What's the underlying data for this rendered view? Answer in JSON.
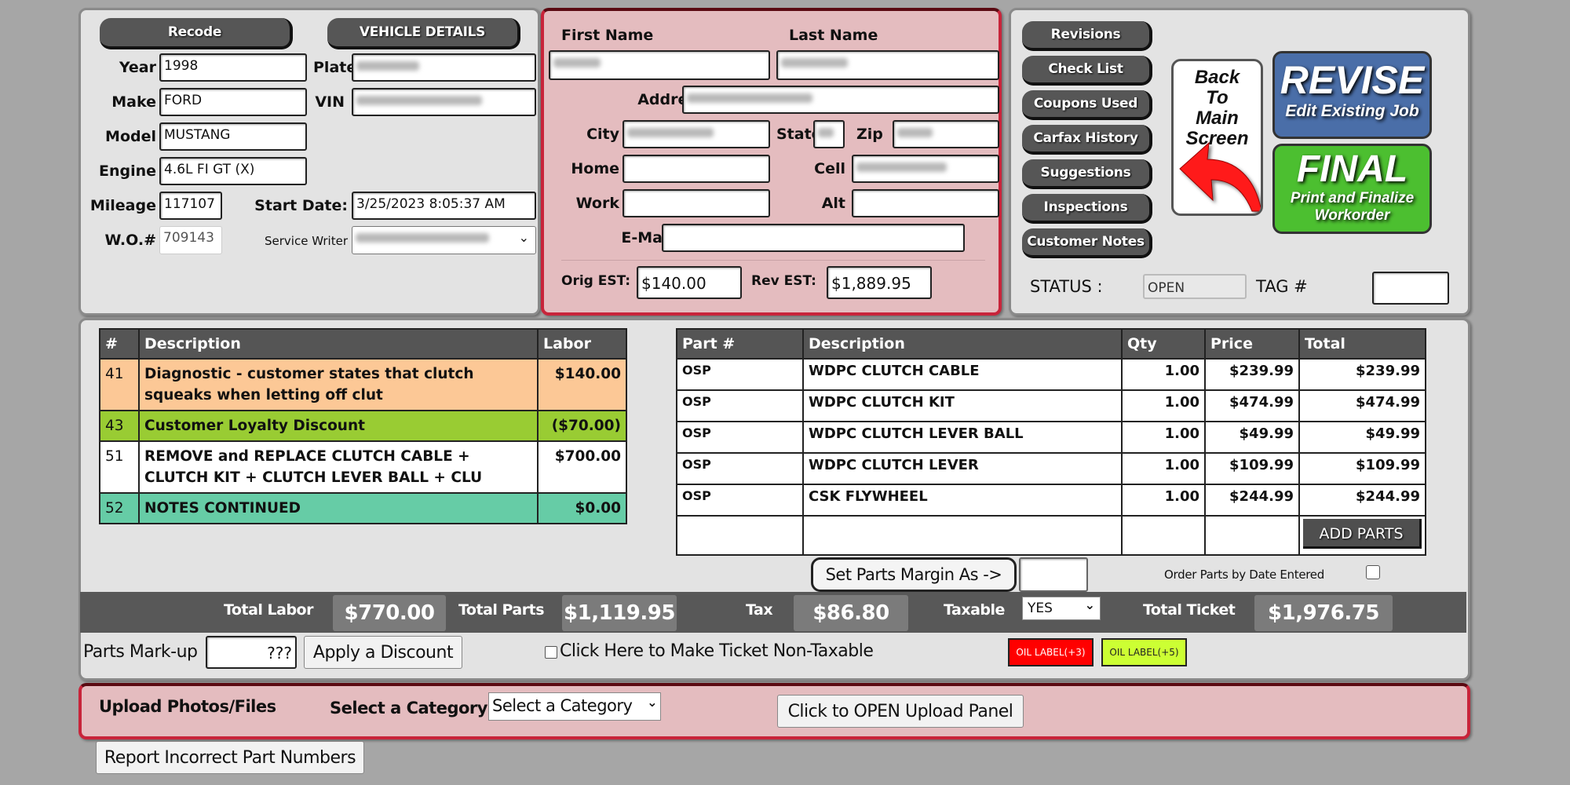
{
  "vehicle": {
    "recode_label": "Recode",
    "details_label": "VEHICLE DETAILS",
    "year_label": "Year",
    "year": "1998",
    "plate_label": "Plate",
    "make_label": "Make",
    "make": "FORD",
    "vin_label": "VIN",
    "model_label": "Model",
    "model": "MUSTANG",
    "engine_label": "Engine",
    "engine": "4.6L FI GT (X)",
    "mileage_label": "Mileage",
    "mileage": "117107",
    "start_date_label": "Start Date:",
    "start_date": "3/25/2023 8:05:37 AM",
    "wo_label": "W.O.#",
    "wo": "709143",
    "service_writer_label": "Service Writer"
  },
  "customer": {
    "first_name_label": "First Name",
    "last_name_label": "Last Name",
    "address_label": "Address",
    "city_label": "City",
    "state_label": "State",
    "zip_label": "Zip",
    "home_label": "Home",
    "cell_label": "Cell",
    "work_label": "Work",
    "alt_label": "Alt",
    "email_label": "E-Mail",
    "orig_est_label": "Orig EST:",
    "orig_est": "$140.00",
    "rev_est_label": "Rev EST:",
    "rev_est": "$1,889.95"
  },
  "actions": {
    "side_buttons": [
      "Revisions",
      "Check List",
      "Coupons Used",
      "Carfax History",
      "Suggestions",
      "Inspections",
      "Customer Notes"
    ],
    "back_label": [
      "Back",
      "To",
      "Main",
      "Screen"
    ],
    "revise_title": "REVISE",
    "revise_sub": "Edit Existing Job",
    "final_title": "FINAL",
    "final_sub1": "Print and Finalize",
    "final_sub2": "Workorder",
    "status_label": "STATUS :",
    "status_value": "OPEN",
    "tag_label": "TAG #",
    "tag_value": ""
  },
  "labor": {
    "headers": [
      "#",
      "Description",
      "Labor"
    ],
    "rows": [
      {
        "num": "41",
        "desc": "Diagnostic - customer states that clutch squeaks when letting off clut",
        "amount": "$140.00",
        "color": "#fcc896"
      },
      {
        "num": "43",
        "desc": "Customer Loyalty Discount",
        "amount": "($70.00)",
        "color": "#99cc33"
      },
      {
        "num": "51",
        "desc": "REMOVE and REPLACE CLUTCH CABLE + CLUTCH KIT + CLUTCH LEVER BALL + CLU",
        "amount": "$700.00",
        "color": "#ffffff"
      },
      {
        "num": "52",
        "desc": "NOTES CONTINUED",
        "amount": "$0.00",
        "color": "#66cca6"
      }
    ]
  },
  "parts": {
    "headers": [
      "Part #",
      "Description",
      "Qty",
      "Price",
      "Total"
    ],
    "rows": [
      {
        "part": "OSP",
        "desc": "WDPC CLUTCH CABLE",
        "qty": "1.00",
        "price": "$239.99",
        "total": "$239.99"
      },
      {
        "part": "OSP",
        "desc": "WDPC CLUTCH KIT",
        "qty": "1.00",
        "price": "$474.99",
        "total": "$474.99"
      },
      {
        "part": "OSP",
        "desc": "WDPC CLUTCH LEVER BALL",
        "qty": "1.00",
        "price": "$49.99",
        "total": "$49.99"
      },
      {
        "part": "OSP",
        "desc": "WDPC CLUTCH LEVER",
        "qty": "1.00",
        "price": "$109.99",
        "total": "$109.99"
      },
      {
        "part": "OSP",
        "desc": "CSK FLYWHEEL",
        "qty": "1.00",
        "price": "$244.99",
        "total": "$244.99"
      }
    ],
    "add_parts_label": "ADD PARTS",
    "set_margin_label": "Set Parts Margin As ->",
    "order_by_date_label": "Order Parts by Date Entered"
  },
  "totals": {
    "labor_label": "Total Labor",
    "labor": "$770.00",
    "parts_label": "Total Parts",
    "parts": "$1,119.95",
    "tax_label": "Tax",
    "tax": "$86.80",
    "taxable_label": "Taxable",
    "taxable": "YES",
    "ticket_label": "Total Ticket",
    "ticket": "$1,976.75"
  },
  "bottom": {
    "markup_label": "Parts Mark-up",
    "markup_value": "???",
    "discount_label": "Apply a Discount",
    "non_taxable_label": "Click Here to Make Ticket Non-Taxable",
    "oil3_label": "OIL LABEL(+3)",
    "oil5_label": "OIL LABEL(+5)",
    "oil3_color": "#ff0000",
    "oil5_color": "#ccff33"
  },
  "upload": {
    "title": "Upload Photos/Files",
    "category_label": "Select a Category",
    "category_value": "Select a Category",
    "open_panel_label": "Click to OPEN Upload Panel"
  },
  "report_label": "Report Incorrect Part Numbers"
}
